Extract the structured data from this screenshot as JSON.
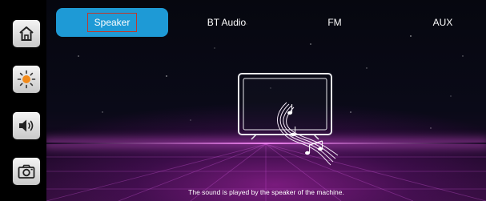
{
  "sidebar": {
    "items": [
      {
        "icon": "home-icon"
      },
      {
        "icon": "brightness-icon"
      },
      {
        "icon": "volume-icon"
      },
      {
        "icon": "camera-icon"
      }
    ]
  },
  "tabs": [
    {
      "label": "Speaker",
      "active": true
    },
    {
      "label": "BT Audio",
      "active": false
    },
    {
      "label": "FM",
      "active": false
    },
    {
      "label": "AUX",
      "active": false
    }
  ],
  "caption": "The sound is played by the speaker of the machine.",
  "colors": {
    "accent": "#1e9ad6",
    "focus_outline": "#c0392b",
    "glow": "#e05ae0"
  }
}
